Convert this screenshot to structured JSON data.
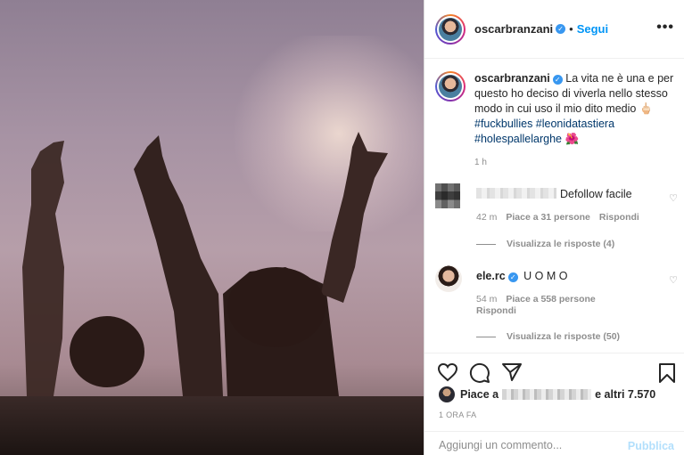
{
  "header": {
    "username": "oscarbranzani",
    "dot": "•",
    "follow_label": "Segui",
    "more_label": "•••"
  },
  "caption": {
    "username": "oscarbranzani",
    "text": "La vita ne è una e per questo ho deciso di viverla nello stesso modo in cui uso il mio dito medio 🖕🏻",
    "hashtags": [
      "#fuckbullies #leonidatastiera",
      "#holespallelarghe 🌺"
    ],
    "time_ago": "1 h"
  },
  "comments": [
    {
      "username_blurred": true,
      "text": "Defollow facile",
      "time": "42 m",
      "likes": "Piace a 31 persone",
      "reply_label": "Rispondi",
      "view_replies": "Visualizza le risposte (4)"
    },
    {
      "username": "ele.rc",
      "text": "U O M O",
      "time": "54 m",
      "likes": "Piace a 558 persone",
      "reply_label": "Rispondi",
      "view_replies": "Visualizza le risposte (50)"
    }
  ],
  "likes": {
    "prefix": "Piace a",
    "suffix": "e altri 7.570"
  },
  "post_time": "1 ORA FA",
  "add_comment": {
    "placeholder": "Aggiungi un commento...",
    "publish_label": "Pubblica"
  },
  "colors": {
    "link_blue": "#0095f6",
    "hashtag_blue": "#00376b",
    "publish_disabled": "#b2dffc",
    "muted_gray": "#8e8e8e"
  },
  "icons": [
    "heart-icon",
    "comment-icon",
    "share-icon",
    "bookmark-icon",
    "verified-badge-icon",
    "more-options-icon"
  ]
}
